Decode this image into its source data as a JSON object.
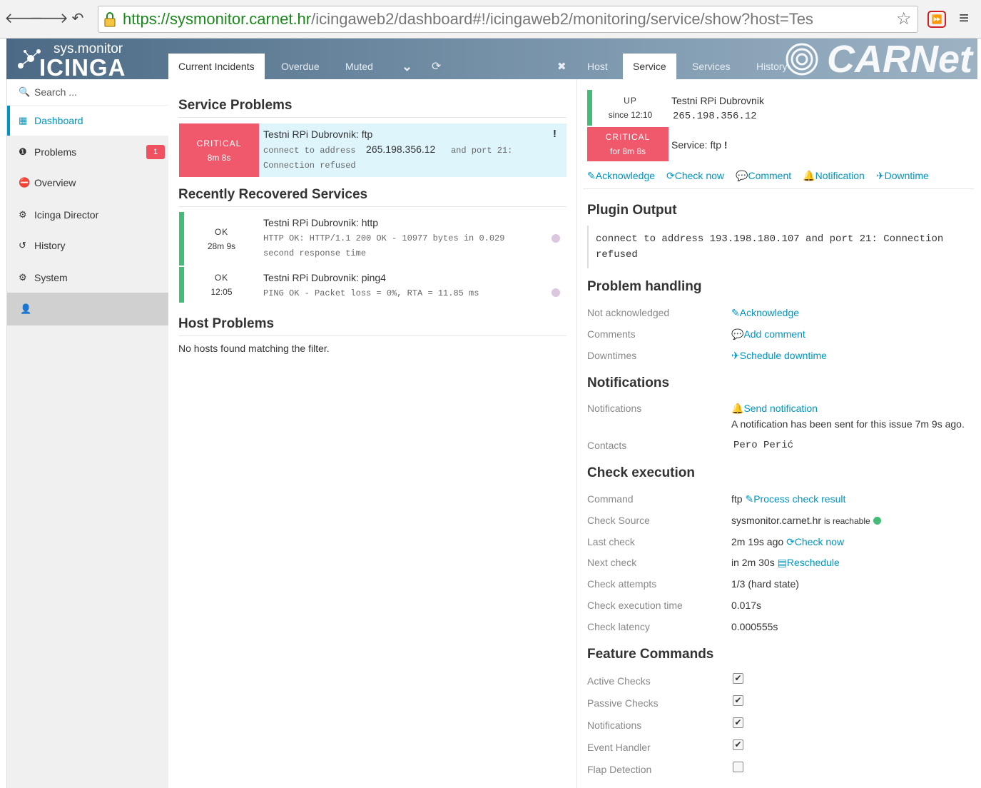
{
  "browser": {
    "url_scheme": "https://",
    "url_host": "sysmonitor.carnet.hr",
    "url_path": "/icingaweb2/dashboard#!/icingaweb2/monitoring/service/show?host=Tes",
    "back_glyph": "🡐",
    "forward_glyph": "🡒",
    "reload_glyph": "↶",
    "star_glyph": "☆",
    "ext_glyph": "⏩",
    "menu_glyph": "≡"
  },
  "header": {
    "logo_small": "sys.monitor",
    "logo_big": "ICINGA",
    "brand": "CARNet",
    "dash_tabs": [
      "Current Incidents",
      "Overdue",
      "Muted"
    ],
    "chevron_glyph": "⌄",
    "refresh_glyph": "⟳",
    "close_glyph": "✖",
    "detail_tabs": [
      "Host",
      "Service",
      "Services",
      "History"
    ]
  },
  "sidebar": {
    "search_placeholder": "Search ...",
    "search_glyph": "🔍",
    "items": [
      {
        "label": "Dashboard",
        "icon": "▦"
      },
      {
        "label": "Problems",
        "icon": "❶"
      },
      {
        "label": "Overview",
        "icon": "⛔"
      },
      {
        "label": "Icinga Director",
        "icon": "⚙"
      },
      {
        "label": "History",
        "icon": "↺"
      },
      {
        "label": "System",
        "icon": "⚙"
      }
    ],
    "problems_badge": "1",
    "user_glyph": "👤"
  },
  "dashboard": {
    "service_problems_title": "Service Problems",
    "problem": {
      "state": "CRITICAL",
      "duration": "8m 8s",
      "title": "Testni RPi Dubrovnik: ftp",
      "out_a": "connect to address",
      "out_ip": "265.198.356.12",
      "out_b": "and port 21:",
      "out_c": "Connection refused",
      "flag": "!"
    },
    "recovered_title": "Recently Recovered Services",
    "recovered": [
      {
        "state": "OK",
        "time": "28m 9s",
        "title": "Testni RPi Dubrovnik: http",
        "out1": "HTTP OK: HTTP/1.1 200 OK - 10977 bytes in 0.029",
        "out2": "second response time"
      },
      {
        "state": "OK",
        "time": "12:05",
        "title": "Testni RPi Dubrovnik: ping4",
        "out1": "PING OK - Packet loss = 0%, RTA = 11.85 ms",
        "out2": ""
      }
    ],
    "host_problems_title": "Host Problems",
    "host_problems_empty": "No hosts found matching the filter."
  },
  "detail": {
    "host_state": "UP",
    "host_since": "since 12:10",
    "host_name": "Testni RPi Dubrovnik",
    "host_ip": "265.198.356.12",
    "svc_state": "CRITICAL",
    "svc_for": "for 8m 8s",
    "svc_label": "Service: ftp",
    "svc_flag": "!",
    "actions": [
      "Acknowledge",
      "Check now",
      "Comment",
      "Notification",
      "Downtime"
    ],
    "action_icons": [
      "✎",
      "⟳",
      "💬",
      "🔔",
      "✈"
    ],
    "plugin_title": "Plugin Output",
    "plugin_output": "connect to address 193.198.180.107 and port 21: Connection refused",
    "problem_title": "Problem handling",
    "problem_rows": [
      {
        "label": "Not acknowledged",
        "value": "Acknowledge",
        "icon": "✎"
      },
      {
        "label": "Comments",
        "value": "Add comment",
        "icon": "💬"
      },
      {
        "label": "Downtimes",
        "value": "Schedule downtime",
        "icon": "✈"
      }
    ],
    "notif_title": "Notifications",
    "notif_label": "Notifications",
    "notif_link": "Send notification",
    "notif_icon": "🔔",
    "notif_text": "A notification has been sent for this issue 7m 9s ago.",
    "contacts_label": "Contacts",
    "contacts_value": "Pero Perić",
    "check_title": "Check execution",
    "command_label": "Command",
    "command_value": "ftp",
    "command_link": "Process check result",
    "source_label": "Check Source",
    "source_value": "sysmonitor.carnet.hr",
    "source_suffix": "is reachable",
    "last_label": "Last check",
    "last_value": "2m 19s ago",
    "last_link": "Check now",
    "next_label": "Next check",
    "next_value": "in 2m 30s",
    "next_link": "Reschedule",
    "attempts_label": "Check attempts",
    "attempts_value": "1/3 (hard state)",
    "exec_label": "Check execution time",
    "exec_value": "0.017s",
    "latency_label": "Check latency",
    "latency_value": "0.000555s",
    "feature_title": "Feature Commands",
    "features": [
      {
        "label": "Active Checks",
        "checked": true
      },
      {
        "label": "Passive Checks",
        "checked": true
      },
      {
        "label": "Notifications",
        "checked": true
      },
      {
        "label": "Event Handler",
        "checked": true
      },
      {
        "label": "Flap Detection",
        "checked": false
      }
    ],
    "check_glyph": "✔"
  }
}
